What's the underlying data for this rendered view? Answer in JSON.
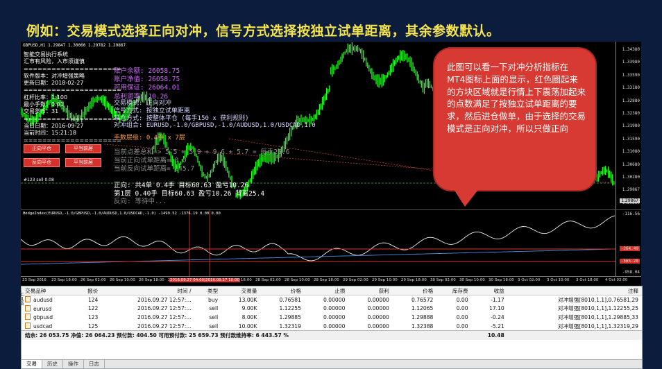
{
  "headline": "例如：交易模式选择正向对冲，信号方式选择按独立试单距离，其余参数默认。",
  "chart": {
    "symbol_title": "GBPUSD,H1  1.29847 1.30060 1.29782 1.29867",
    "ea_info": [
      "智能交易执行系统",
      "汇市有风险，入市须谨慎",
      "=====================",
      "软件版本：对冲增强策略",
      "更新日期：2018-02-27",
      "=====================",
      "杠杆比率：1:100",
      "最小手数：0.01",
      "交易货币：31",
      "=====================",
      "当日日期：2016-09-27",
      "当前时间：15:21:18",
      "=====================",
      "标识编号：10"
    ],
    "account_rows": [
      "账户余额:    26058.75",
      "账户净值:    26058.75",
      "可用保证:    26064.01",
      "总利润率:       10.26"
    ],
    "info_rows": [
      "交易模式: 正向对冲",
      "信号方式: 按独立试单距离",
      "平仓方式: 按整体平仓 (每手150 x 获利规则)",
      "对冲组合: EURUSD,-1.0/GBPUSD,-1.0/AUDUSD,1.0/USDCAD,1.0"
    ],
    "lot_row": "手数层级: 0.4手 x 7层",
    "gray_rows": [
      "当前点差总和=> 5.5 + 5.9 + 9.6 + 5.7 = 每手26.6",
      "当前正向试单距离= 0.0",
      "当前反向试单距离= 245.7"
    ],
    "status_rows": [
      "正向: 共4单 0.4手 目标60.63 盈亏10.26",
      "     第1层 0.40手 目标60.63 盈亏10.26 背离25.4",
      "反向: 等待中..."
    ],
    "buttons": {
      "forward_close": "正向平仓",
      "close_current": "平当前层",
      "reverse_close": "反向平仓",
      "close_current2": "平当前层"
    },
    "order_label": "#123 sell 0.08",
    "price_ticks": [
      "1.34380",
      "1.33980",
      "1.33590",
      "1.33180",
      "1.32880",
      "1.32380",
      "1.31980",
      "1.31590",
      "1.31080",
      "1.30680",
      "1.30280",
      "1.29867",
      "1.29380"
    ],
    "current_price": "1.29867"
  },
  "bubble": {
    "text": "此图可以看一下对冲分析指标在MT4图标上面的显示，红色圈起来的方块区域就是行情上下震荡加起来的点数满足了按独立试单距离的要求，然后进仓做单，由于选择的交易模式是正向对冲，所以只做正向"
  },
  "indicator": {
    "title": "HedgeIndex(EURUSD,-1.0/GBPUSD,-1.0/AUDUSD,1.0/USDCAD,-1.0) -1499.52 -1376.19 0.00 0.00",
    "top_value": "-116.56",
    "tag1": "-264.49",
    "tag2": "-565.28",
    "bottom_value": "-958.04"
  },
  "time_axis": [
    "23 Sep 2016",
    "23 Sep 18:00",
    "26 Sep 02:00",
    "26 Sep 10:00",
    "26 Sep 18:00",
    "27 Sep 02:00",
    "27 Sep 10:00",
    "27 Sep 18:00",
    "28 Sep 02:00",
    "28 Sep 10:00",
    "28 Sep 18:00",
    "29 Sep 02:00",
    "29 Sep 10:00",
    "29 Sep 18:00",
    "30 Sep 02:00",
    "30 Sep 10:00",
    "30 Sep 18:00",
    "3 Oct 02:00",
    "3 Oct 10:00",
    "3 Oct 18:00",
    "4 Oct 02:00"
  ],
  "time_highlight": "2016.09.27 04:00|2016.09.27 10:00",
  "terminal": {
    "headers": [
      "交易品种",
      "报价",
      "时间 /",
      "类型",
      "交易量",
      "价格",
      "止损",
      "获利",
      "价格",
      "库存费",
      "收益",
      "注释"
    ],
    "rows": [
      {
        "symbol": "audusd",
        "ticket": "124",
        "time": "2016.09.27 12:57:...",
        "type": "buy",
        "volume": "13.00K",
        "price": "0.76581",
        "sl": "0.00000",
        "tp": "0.00000",
        "cur": "0.76572",
        "swap": "0.00",
        "profit": "-1.17",
        "comment": "对冲增强[8010,1,1],0.76581,29"
      },
      {
        "symbol": "eurusd",
        "ticket": "122",
        "time": "2016.09.27 12:57:...",
        "type": "sell",
        "volume": "9.00K",
        "price": "1.12255",
        "sl": "0.00000",
        "tp": "0.00000",
        "cur": "1.12065",
        "swap": "0.00",
        "profit": "17.10",
        "comment": "对冲增强[8010,1,1],1.12255,25"
      },
      {
        "symbol": "gbpusd",
        "ticket": "123",
        "time": "2016.09.27 12:57:...",
        "type": "sell",
        "volume": "8.00K",
        "price": "1.29885",
        "sl": "0.00000",
        "tp": "0.00000",
        "cur": "1.29888",
        "swap": "0.00",
        "profit": "-0.24",
        "comment": "对冲增强[8010,1,1],1.29885,33"
      },
      {
        "symbol": "usdcad",
        "ticket": "125",
        "time": "2016.09.27 12:57:...",
        "type": "sell",
        "volume": "10.00K",
        "price": "1.32319",
        "sl": "0.00000",
        "tp": "0.00000",
        "cur": "1.32388",
        "swap": "0.00",
        "profit": "-5.21",
        "comment": "对冲增强[8010,1,1],1.32319,29"
      }
    ],
    "summary": "结余: 26 053.75  净值: 26 064.23  预付款: 404.50  可用预付款: 25 659.73  预付款维持率: 6 443.57 %",
    "summary_profit": "10.48",
    "tabs": [
      "交易",
      "历史",
      "操作",
      "日志"
    ],
    "side_label": "工具箱"
  },
  "colors": {
    "candle": "#19ff19",
    "bubble": "#d63a33",
    "headline": "#f5e44a"
  }
}
